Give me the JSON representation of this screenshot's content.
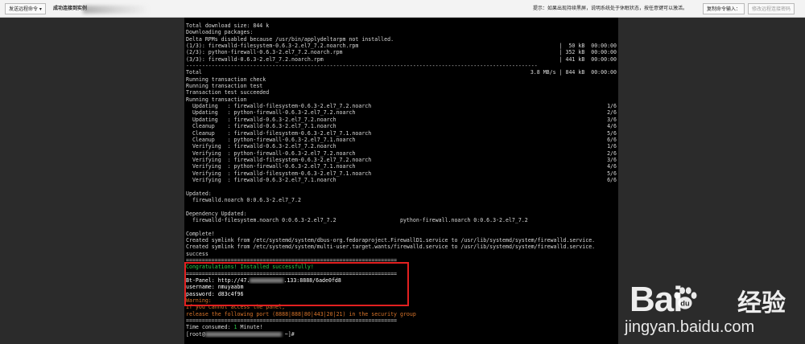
{
  "toolbar": {
    "send_command_label": "发送远程命令 ▾",
    "status": "成功连接到实例",
    "hint": "提示：如果出现持续黑屏，说明系统处于休眠状态，按任意键可以激活。",
    "copy_command_label": "复制命令输入：",
    "modify_password_label": "修改远程连接密码"
  },
  "terminal": {
    "lines": [
      {
        "t": "Total download size: 844 k"
      },
      {
        "t": "Downloading packages:"
      },
      {
        "t": "Delta RPMs disabled because /usr/bin/applydeltarpm not installed."
      },
      {
        "t": "(1/3): firewalld-filesystem-0.6.3-2.el7_7.2.noarch.rpm",
        "r": "|  50 kB  00:00:00"
      },
      {
        "t": "(2/3): python-firewall-0.6.3-2.el7_7.2.noarch.rpm",
        "r": "| 352 kB  00:00:00"
      },
      {
        "t": "(3/3): firewalld-0.6.3-2.el7_7.2.noarch.rpm",
        "r": "| 441 kB  00:00:00"
      },
      {
        "t": "--------------------------------------------------------------------------------------------------------------"
      },
      {
        "t": "Total",
        "r": "3.8 MB/s | 844 kB  00:00:00"
      },
      {
        "t": "Running transaction check"
      },
      {
        "t": "Running transaction test"
      },
      {
        "t": "Transaction test succeeded"
      },
      {
        "t": "Running transaction"
      },
      {
        "t": "  Updating   : firewalld-filesystem-0.6.3-2.el7_7.2.noarch",
        "r": "1/6"
      },
      {
        "t": "  Updating   : python-firewall-0.6.3-2.el7_7.2.noarch",
        "r": "2/6"
      },
      {
        "t": "  Updating   : firewalld-0.6.3-2.el7_7.2.noarch",
        "r": "3/6"
      },
      {
        "t": "  Cleanup    : firewalld-0.6.3-2.el7_7.1.noarch",
        "r": "4/6"
      },
      {
        "t": "  Cleanup    : firewalld-filesystem-0.6.3-2.el7_7.1.noarch",
        "r": "5/6"
      },
      {
        "t": "  Cleanup    : python-firewall-0.6.3-2.el7_7.1.noarch",
        "r": "6/6"
      },
      {
        "t": "  Verifying  : firewalld-0.6.3-2.el7_7.2.noarch",
        "r": "1/6"
      },
      {
        "t": "  Verifying  : python-firewall-0.6.3-2.el7_7.2.noarch",
        "r": "2/6"
      },
      {
        "t": "  Verifying  : firewalld-filesystem-0.6.3-2.el7_7.2.noarch",
        "r": "3/6"
      },
      {
        "t": "  Verifying  : python-firewall-0.6.3-2.el7_7.1.noarch",
        "r": "4/6"
      },
      {
        "t": "  Verifying  : firewalld-filesystem-0.6.3-2.el7_7.1.noarch",
        "r": "5/6"
      },
      {
        "t": "  Verifying  : firewalld-0.6.3-2.el7_7.1.noarch",
        "r": "6/6"
      },
      {
        "t": ""
      },
      {
        "t": "Updated:"
      },
      {
        "t": "  firewalld.noarch 0:0.6.3-2.el7_7.2"
      },
      {
        "t": ""
      },
      {
        "t": "Dependency Updated:"
      },
      {
        "t": "  firewalld-filesystem.noarch 0:0.6.3-2.el7_7.2                    python-firewall.noarch 0:0.6.3-2.el7_7.2"
      },
      {
        "t": ""
      },
      {
        "t": "Complete!"
      },
      {
        "t": "Created symlink from /etc/systemd/system/dbus-org.fedoraproject.FirewallD1.service to /usr/lib/systemd/system/firewalld.service."
      },
      {
        "t": "Created symlink from /etc/systemd/system/multi-user.target.wants/firewalld.service to /usr/lib/systemd/system/firewalld.service."
      },
      {
        "t": "success"
      },
      {
        "t": "=================================================================="
      },
      {
        "t": "Congratulations! Installed successfully!",
        "c": "g"
      },
      {
        "t": "=================================================================="
      },
      {
        "t": "Bt-Panel: http://47.",
        "mask": "short",
        "t2": ".133:8888/6ade0fd8",
        "c": "w"
      },
      {
        "t": "username: nmuyaabm",
        "c": "w"
      },
      {
        "t": "password: d83c4f96",
        "c": "w"
      },
      {
        "t": "Warning:",
        "c": "o"
      },
      {
        "t": "If you cannot access the panel,",
        "c": "o"
      },
      {
        "t": "release the following port (8888|888|80|443|20|21) in the security group",
        "c": "o"
      },
      {
        "t": "=================================================================="
      },
      {
        "t": "Time consumed: ",
        "t2": "1",
        "t3": " Minute!"
      },
      {
        "t": "[root@",
        "mask": "long",
        "t2": " ~]# "
      }
    ]
  },
  "watermark": {
    "brand": "Bai",
    "brand_cn": "经验",
    "url": "jingyan.baidu.com"
  }
}
